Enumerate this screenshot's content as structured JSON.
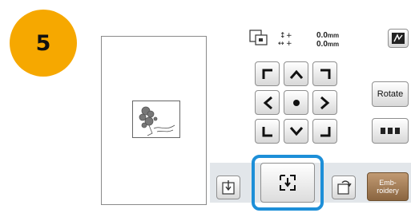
{
  "step": {
    "number": "5"
  },
  "preview": {
    "pattern": "flower-embroidery-pattern"
  },
  "panel": {
    "readout_x": "0.0",
    "readout_y": "0.0",
    "unit": "mm",
    "rotate_label": "Rotate",
    "embroidery_label_1": "Emb-",
    "embroidery_label_2": "roidery"
  },
  "icons": {
    "size_icon": "frame-size-icon",
    "position_icon": "move-arrows-icon",
    "density_icon": "stitch-display-icon",
    "trial_icon": "trial-stitch-icon",
    "frame_icon": "frame-move-icon"
  },
  "colors": {
    "badge": "#f6a800",
    "highlight": "#1d8fd8",
    "embroidery_button": "#a07a55"
  }
}
